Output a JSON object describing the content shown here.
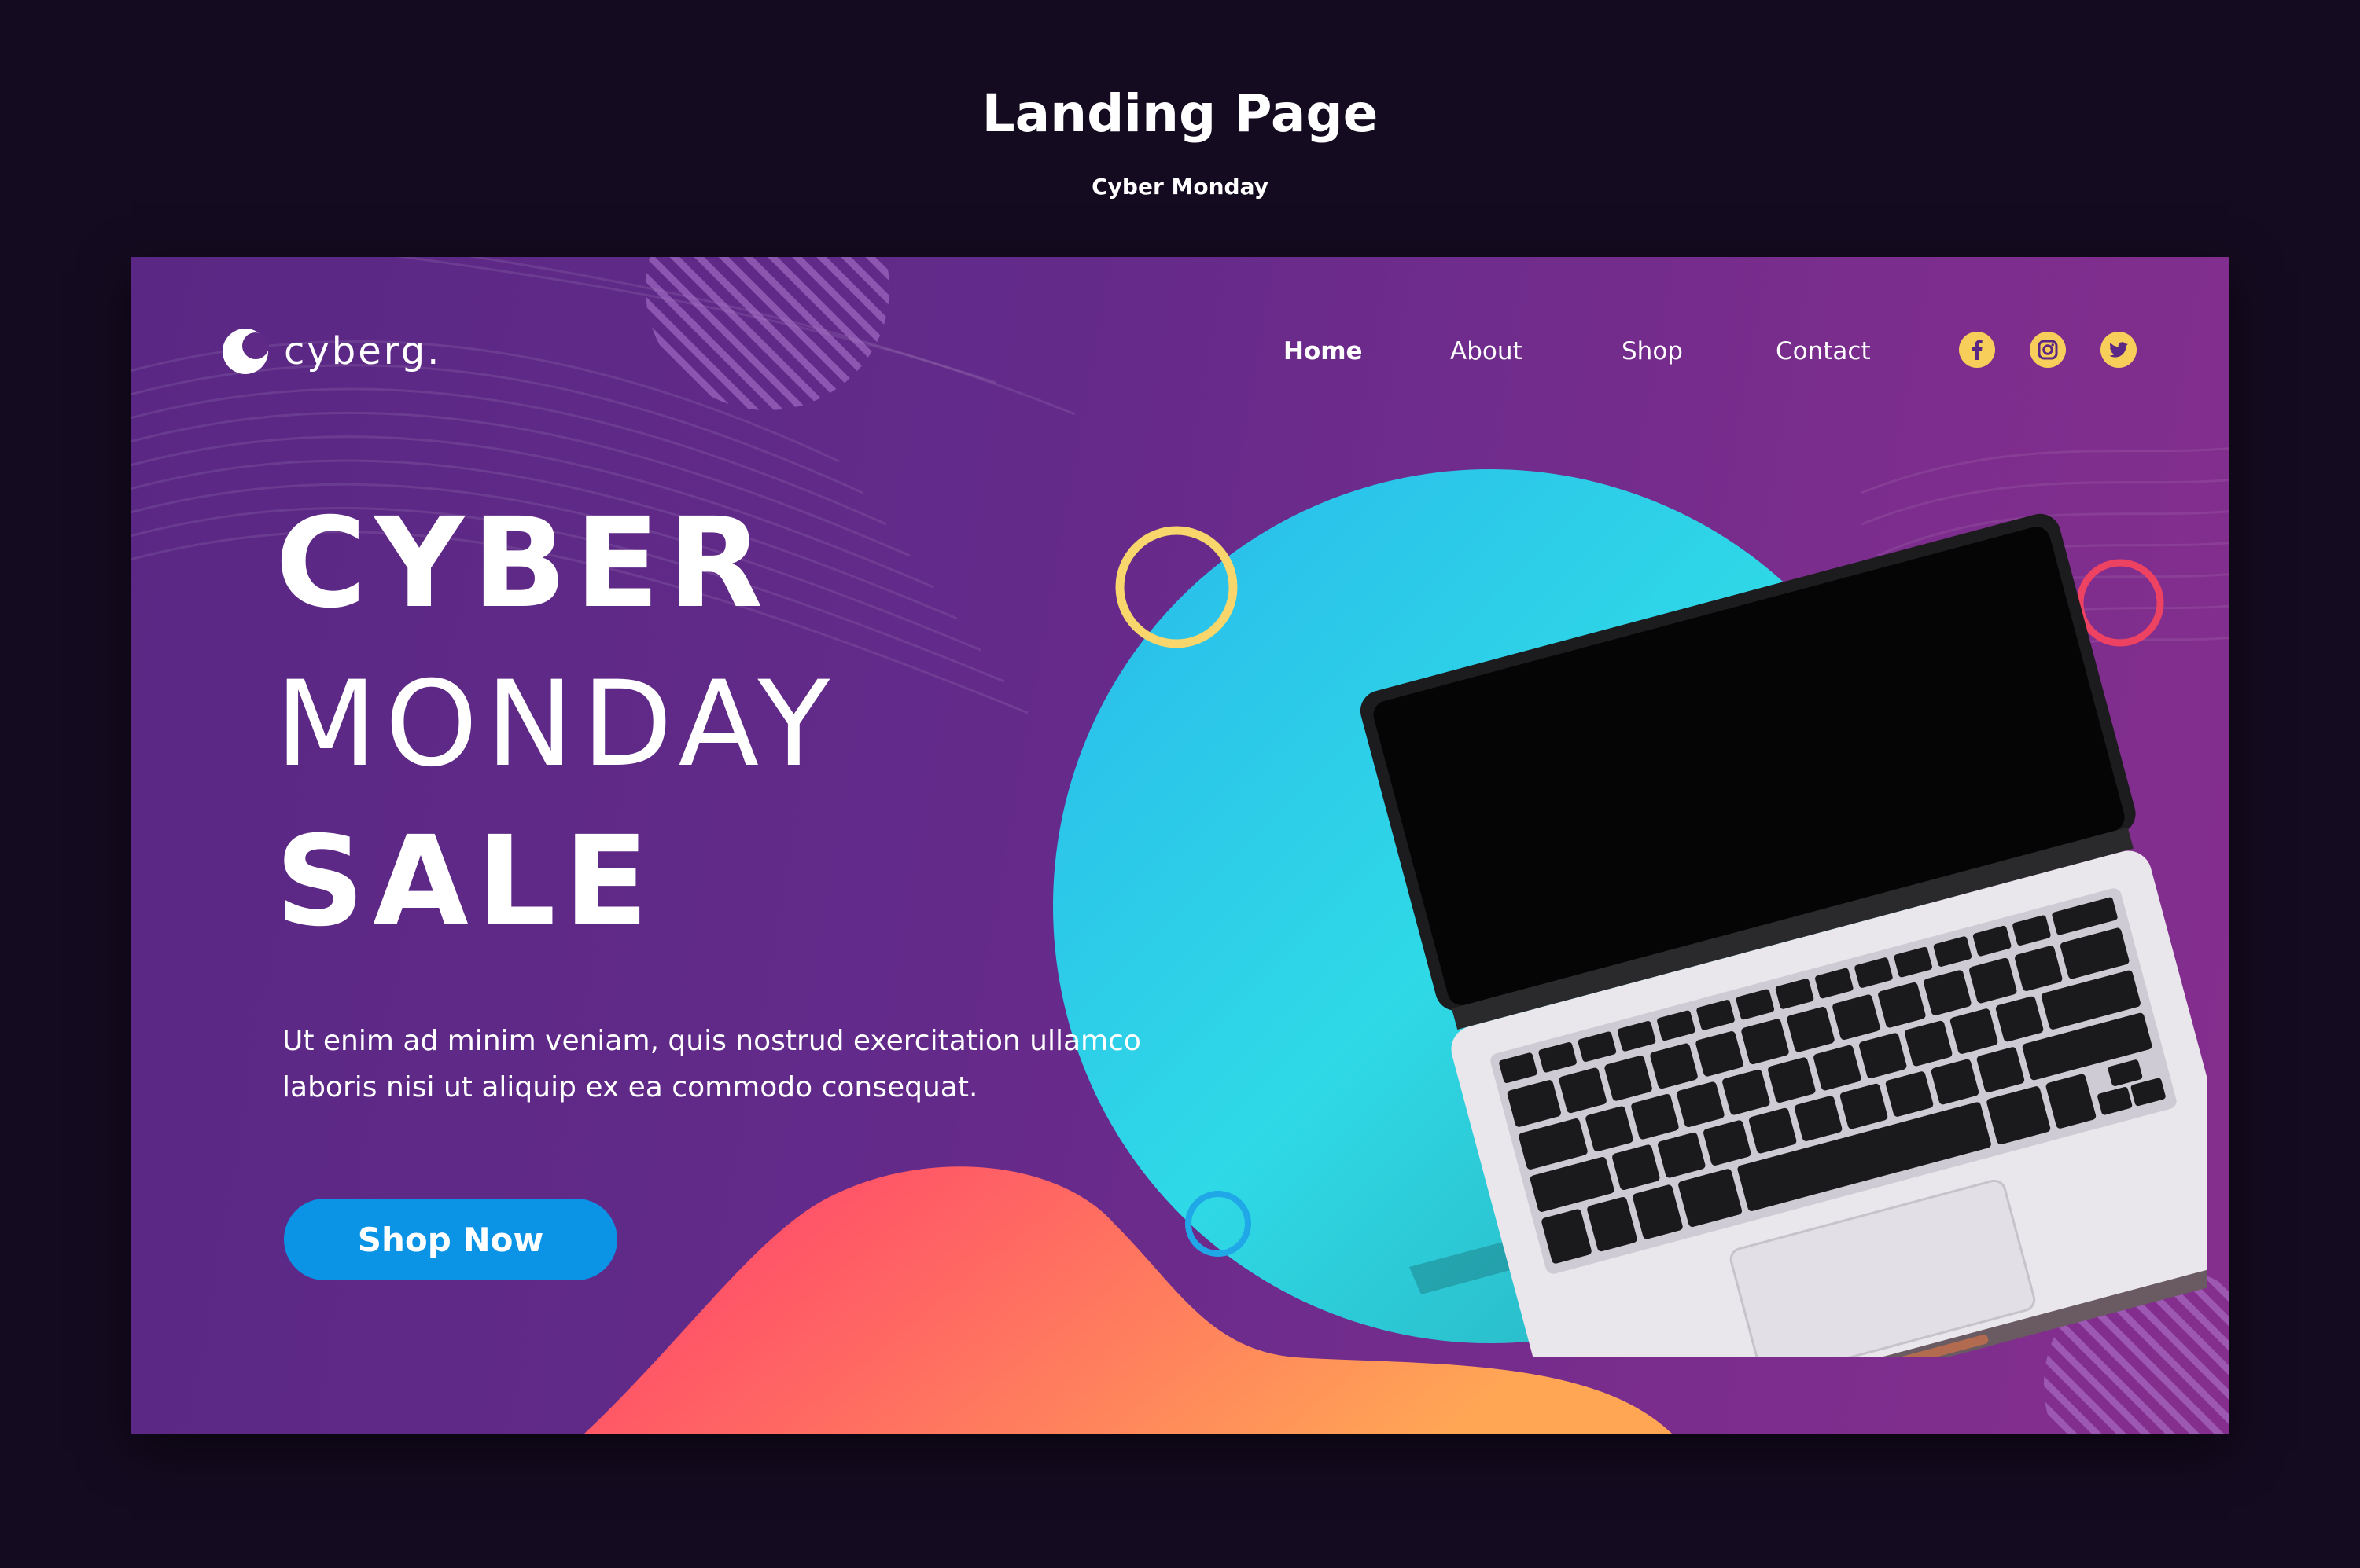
{
  "page": {
    "title": "Landing Page",
    "subtitle": "Cyber Monday"
  },
  "brand": {
    "name": "cyberg.",
    "logo_icon": "crescent-logo-icon"
  },
  "nav": {
    "items": [
      {
        "label": "Home",
        "active": true
      },
      {
        "label": "About",
        "active": false
      },
      {
        "label": "Shop",
        "active": false
      },
      {
        "label": "Contact",
        "active": false
      }
    ]
  },
  "social": [
    {
      "name": "facebook-icon"
    },
    {
      "name": "instagram-icon"
    },
    {
      "name": "twitter-icon"
    }
  ],
  "hero": {
    "line1": "CYBER",
    "line2": "MONDAY",
    "line3": "SALE",
    "description_line1": "Ut enim ad minim veniam, quis nostrud exercitation ullamco",
    "description_line2": "laboris nisi ut aliquip ex ea commodo consequat.",
    "cta_label": "Shop Now"
  },
  "colors": {
    "page_background": "#150b20",
    "banner_purple": "#632a8a",
    "cta_blue": "#0b94e6",
    "social_yellow": "#f8ce5b",
    "ring_yellow": "#f8d66b",
    "ring_red": "#ee4262",
    "ring_blue": "#1fa7e8",
    "circle_cyan": "#2fd9e6",
    "wave_coral": "#ff5a6e"
  }
}
